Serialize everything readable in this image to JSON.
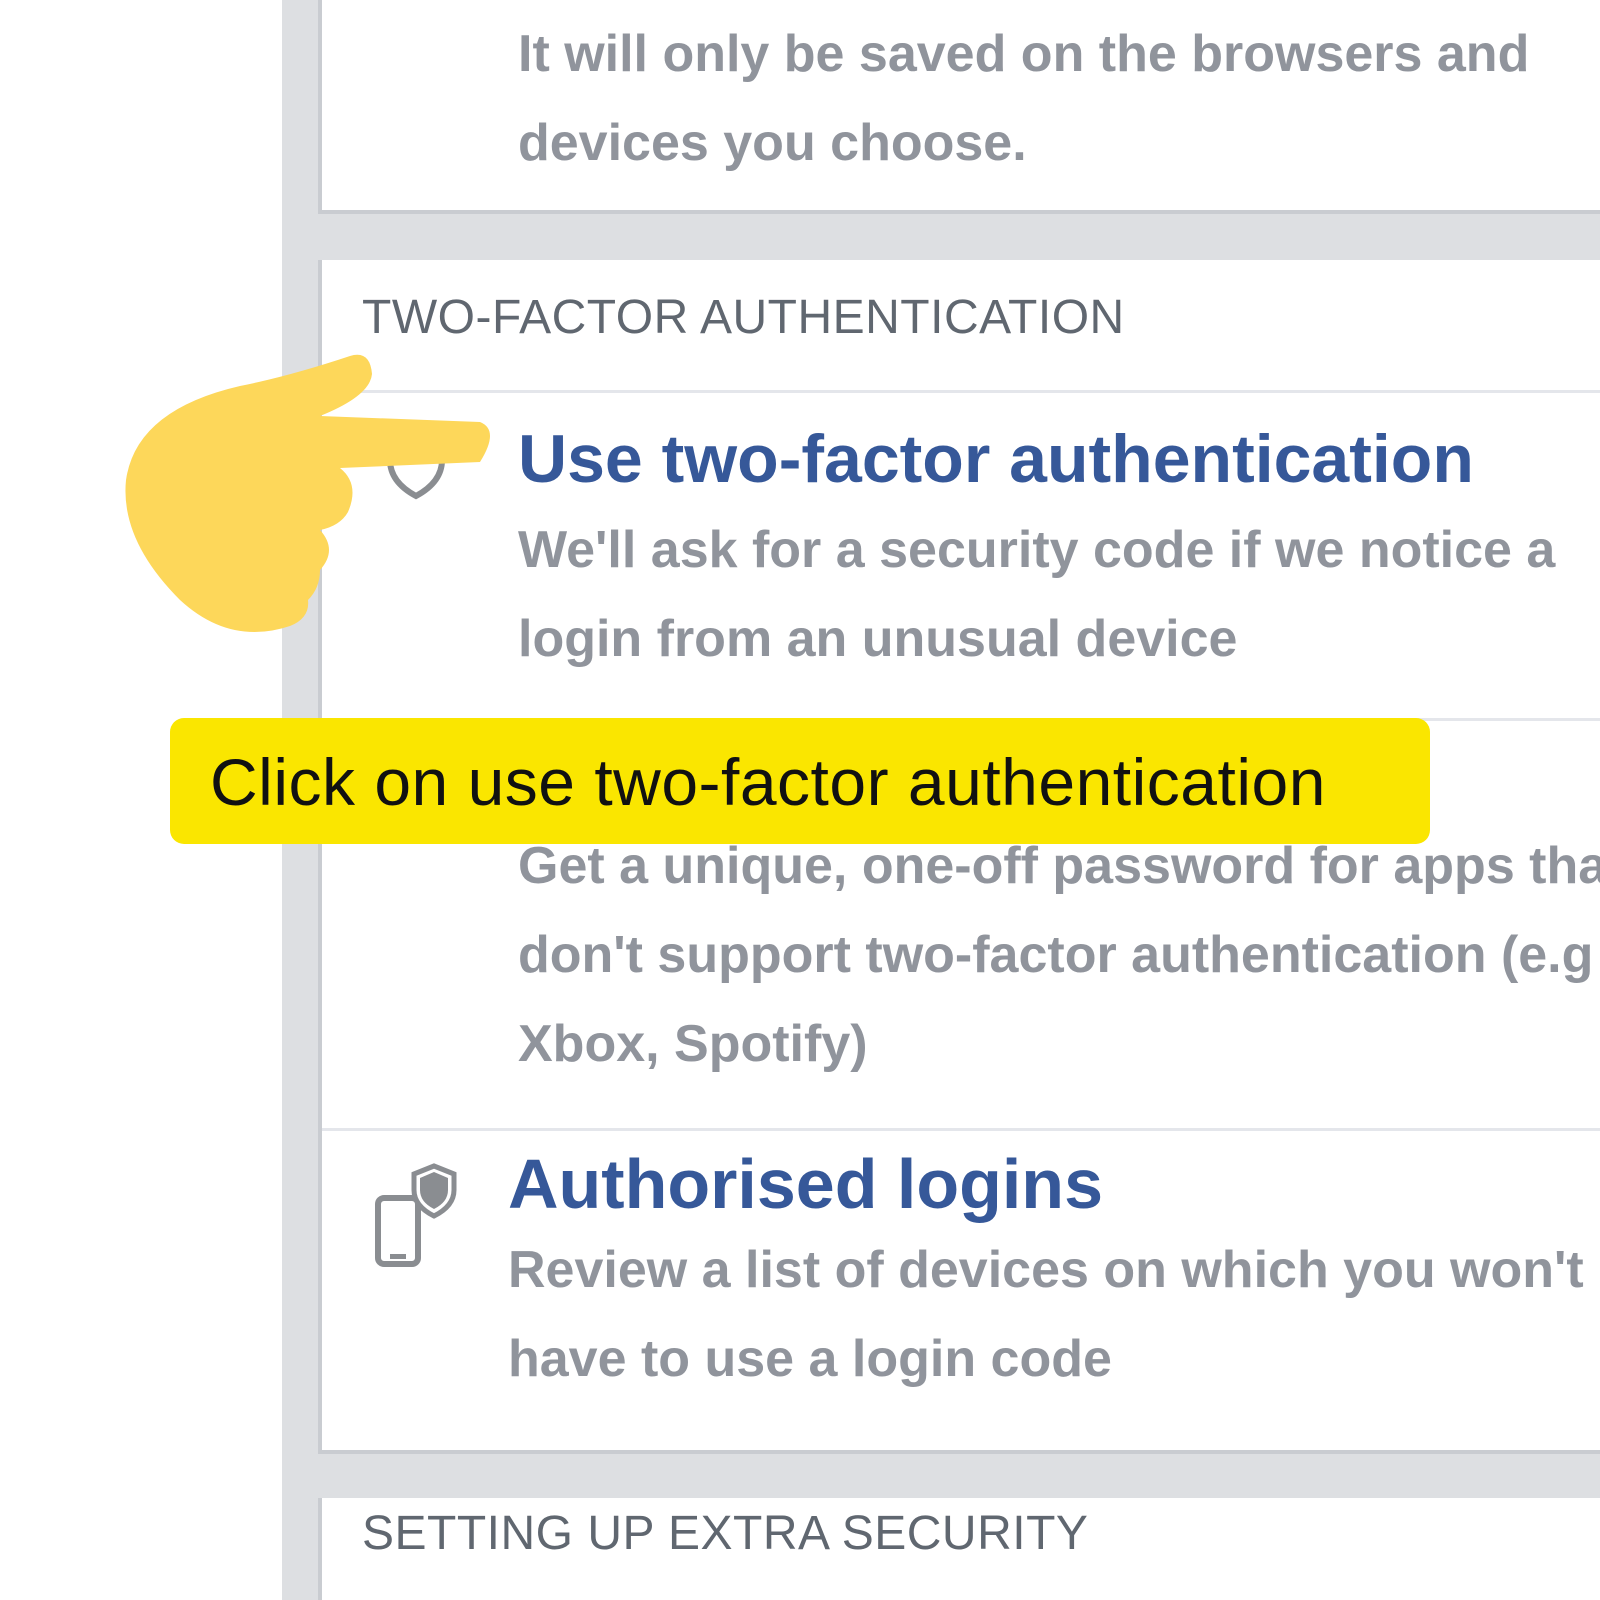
{
  "top_card": {
    "desc_lines": [
      "It will only be saved on the browsers and",
      "devices you choose."
    ]
  },
  "two_factor_section": {
    "header": "TWO-FACTOR AUTHENTICATION",
    "use_2fa": {
      "title": "Use two-factor authentication",
      "desc_lines": [
        "We'll ask for a security code if we notice a",
        "login from an unusual device"
      ],
      "icon": "shield-icon"
    },
    "app_passwords": {
      "desc_lines": [
        "Get a unique, one-off password for apps tha",
        "don't support two-factor authentication (e.g",
        "Xbox, Spotify)"
      ]
    },
    "authorised_logins": {
      "title": "Authorised logins",
      "desc_lines": [
        "Review a list of devices on which you won't",
        "have to use a login code"
      ],
      "icon": "phone-shield-icon"
    }
  },
  "extra_security_section": {
    "header": "SETTING UP EXTRA SECURITY"
  },
  "instruction": {
    "text": "Click on use two-factor authentication",
    "pointer_icon": "pointing-hand-icon",
    "highlight_color": "#fae600",
    "hand_color": "#fdd75a"
  },
  "colors": {
    "link_blue": "#365899",
    "text_gray": "#90949c",
    "page_gray": "#dddfe2"
  }
}
